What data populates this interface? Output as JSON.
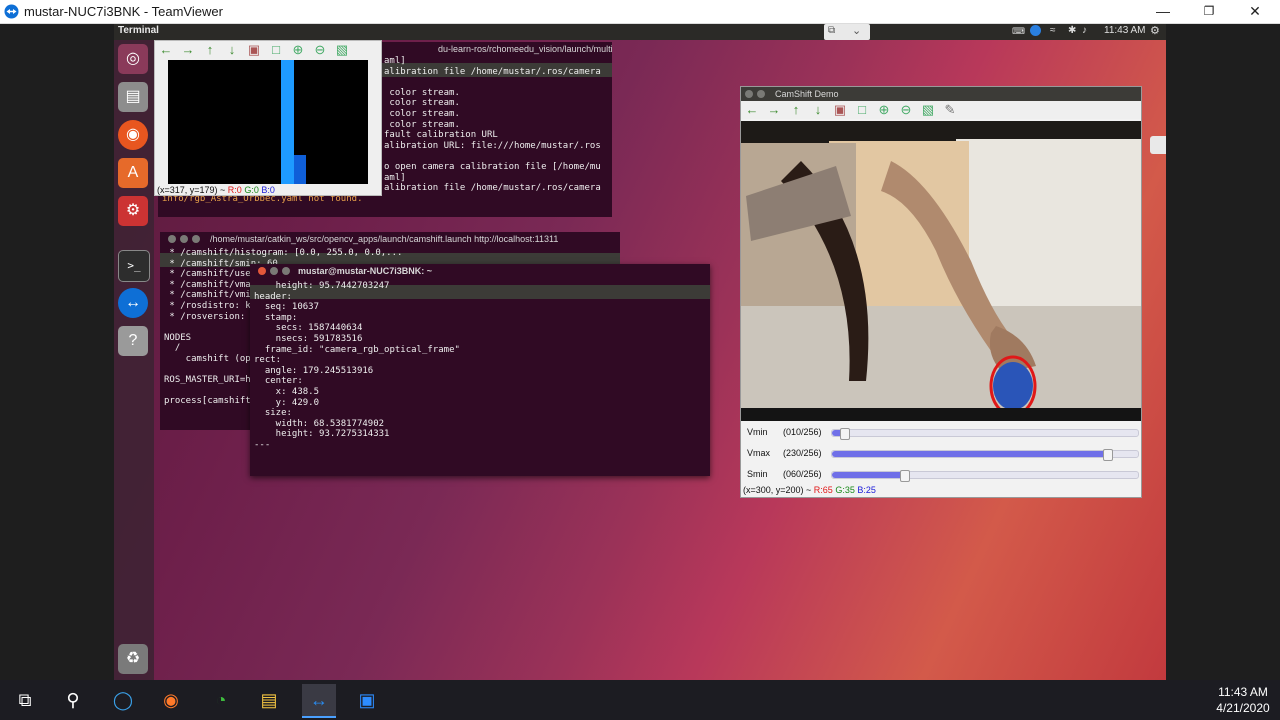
{
  "host": {
    "title": "mustar-NUC7i3BNK - TeamViewer",
    "clock_time": "11:43 AM",
    "clock_date": "4/21/2020"
  },
  "remote": {
    "topbar_title": "Terminal",
    "topbar_clock": "11:43 AM"
  },
  "camshift_window": {
    "title": "CamShift Demo",
    "sliders": [
      {
        "label": "Vmin",
        "value": "(010/256)",
        "level": 0.039
      },
      {
        "label": "Vmax",
        "value": "(230/256)",
        "level": 0.898
      },
      {
        "label": "Smin",
        "value": "(060/256)",
        "level": 0.234
      }
    ],
    "status_coord": "(x=300, y=200) ~ ",
    "status_r": "R:65",
    "status_g": "G:35",
    "status_b": "B:25"
  },
  "histogram_window": {
    "status_coord": "(x=317, y=179) ~ ",
    "status_r": "R:0",
    "status_g": "G:0",
    "status_b": "B:0"
  },
  "term_back": {
    "path": "du-learn-ros/rchomeedu_vision/launch/multi_as",
    "lines": [
      "aml]",
      "alibration file /home/mustar/.ros/camera",
      "",
      " color stream.",
      " color stream.",
      " color stream.",
      " color stream.",
      "fault calibration URL",
      "alibration URL: file:///home/mustar/.ros",
      "",
      "o open camera calibration file [/home/mu",
      "aml]",
      "alibration file /home/mustar/.ros/camera"
    ],
    "footer": "info/rgb_Astra_Orbbec.yaml not found."
  },
  "term_launch": {
    "title": "/home/mustar/catkin_ws/src/opencv_apps/launch/camshift.launch http://localhost:11311",
    "lines": [
      " * /camshift/histogram: [0.0, 255.0, 0.0,...",
      " * /camshift/smin: 60",
      " * /camshift/use",
      " * /camshift/vma",
      " * /camshift/vmi",
      " * /rosdistro: k",
      " * /rosversion:",
      "",
      "NODES",
      "  /",
      "    camshift (op",
      "",
      "ROS_MASTER_URI=h",
      "",
      "process[camshift"
    ]
  },
  "term_echo": {
    "title": "mustar@mustar-NUC7i3BNK: ~",
    "lines": [
      "    height: 95.7442703247",
      "header:",
      "  seq: 10637",
      "  stamp:",
      "    secs: 1587440634",
      "    nsecs: 591783516",
      "  frame_id: \"camera_rgb_optical_frame\"",
      "rect:",
      "  angle: 179.245513916",
      "  center:",
      "    x: 438.5",
      "    y: 429.0",
      "  size:",
      "    width: 68.5381774902",
      "    height: 93.7275314331",
      "---"
    ]
  },
  "colors": {
    "terminal_bg": "#300a24",
    "histogram_bar": "#1e9bff",
    "tracking_ellipse": "#e01818"
  }
}
